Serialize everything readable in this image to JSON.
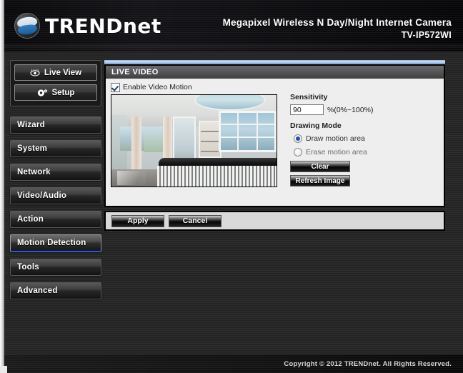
{
  "header": {
    "brand": "TRENDnet",
    "brand_icon": "globe-swoosh-logo",
    "product_title": "Megapixel Wireless N Day/Night Internet Camera",
    "model": "TV-IP572WI"
  },
  "sidebar": {
    "modes": [
      {
        "label": "Live View",
        "icon": "eye-icon"
      },
      {
        "label": "Setup",
        "icon": "gear-icon"
      }
    ],
    "items": [
      {
        "label": "Wizard",
        "active": false
      },
      {
        "label": "System",
        "active": false
      },
      {
        "label": "Network",
        "active": false
      },
      {
        "label": "Video/Audio",
        "active": false
      },
      {
        "label": "Action",
        "active": false
      },
      {
        "label": "Motion Detection",
        "active": true
      },
      {
        "label": "Tools",
        "active": false
      },
      {
        "label": "Advanced",
        "active": false
      }
    ]
  },
  "panel": {
    "title": "LIVE VIDEO",
    "enable_video_motion": {
      "label": "Enable Video Motion",
      "checked": true
    },
    "sensitivity": {
      "label": "Sensitivity",
      "value": "90",
      "unit": "%(0%~100%)"
    },
    "drawing_mode": {
      "label": "Drawing Mode",
      "options": [
        {
          "label": "Draw motion area",
          "selected": true
        },
        {
          "label": "Erase motion area",
          "selected": false
        }
      ]
    },
    "buttons": {
      "clear": "Clear",
      "refresh_image": "Refresh Image"
    }
  },
  "actions": {
    "apply": "Apply",
    "cancel": "Cancel"
  },
  "footer": {
    "copyright": "Copyright © 2012 TRENDnet. All Rights Reserved."
  },
  "colors": {
    "accent_blue": "#2b56d8",
    "panel_bg": "#eeeeee",
    "header_bg": "#0d0d10",
    "radio_selected": "#1f4fae"
  }
}
